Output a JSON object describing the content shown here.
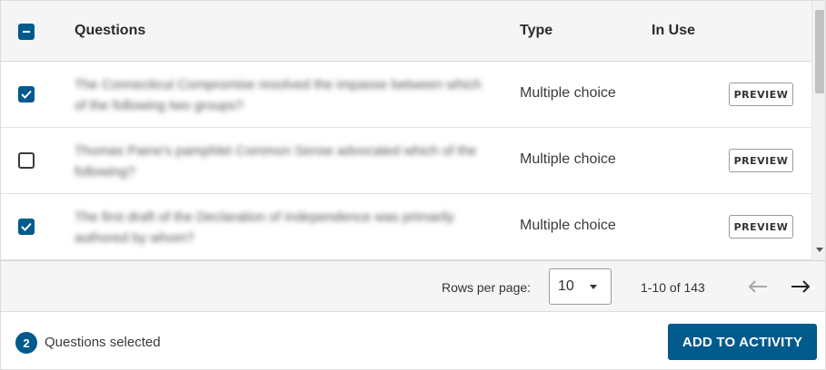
{
  "table": {
    "headers": {
      "questions": "Questions",
      "type": "Type",
      "in_use": "In Use"
    },
    "select_all_state": "indeterminate",
    "rows": [
      {
        "checked": true,
        "question": "The Connecticut Compromise resolved the impasse between which of the following two groups?",
        "type": "Multiple choice",
        "preview_label": "PREVIEW"
      },
      {
        "checked": false,
        "question": "Thomas Paine's pamphlet Common Sense advocated which of the following?",
        "type": "Multiple choice",
        "preview_label": "PREVIEW"
      },
      {
        "checked": true,
        "question": "The first draft of the Declaration of Independence was primarily authored by whom?",
        "type": "Multiple choice",
        "preview_label": "PREVIEW"
      }
    ]
  },
  "pagination": {
    "rows_per_page_label": "Rows per page:",
    "rows_per_page_value": "10",
    "range_text": "1-10 of 143"
  },
  "selection": {
    "count": "2",
    "label": "Questions selected"
  },
  "actions": {
    "add_to_activity": "ADD TO ACTIVITY"
  },
  "colors": {
    "accent": "#005a8c",
    "header_bg": "#f5f5f5"
  },
  "icons": {
    "select_all": "minus-checkbox-icon",
    "row_checked": "checkmark-icon",
    "prev": "arrow-left-icon",
    "next": "arrow-right-icon",
    "dropdown": "caret-down-icon"
  }
}
